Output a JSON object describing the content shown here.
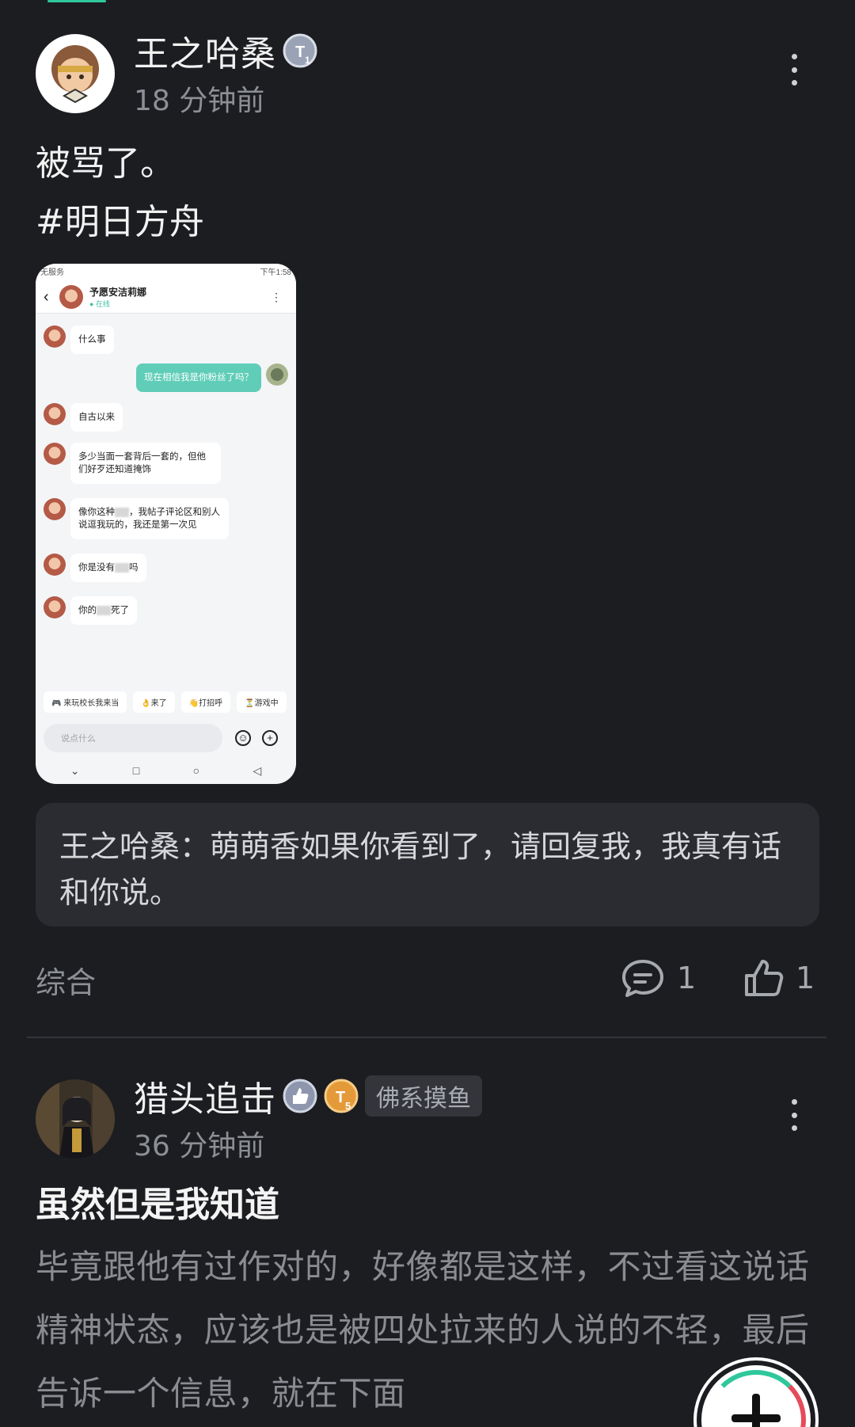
{
  "post1": {
    "author": "王之哈桑",
    "level_badge": "T1",
    "time": "18 分钟前",
    "text_lines": [
      "被骂了。",
      "#明日方舟"
    ],
    "image": {
      "status_left": "无服务",
      "status_right": "下午1:58",
      "peer_name": "予愿安洁莉娜",
      "peer_status": "● 在线",
      "messages": [
        {
          "from": "peer",
          "text": "什么事"
        },
        {
          "from": "me",
          "text": "现在相信我是你粉丝了吗？"
        },
        {
          "from": "peer",
          "text": "自古以来"
        },
        {
          "from": "peer",
          "text": "多少当面一套背后一套的，但他们好歹还知道掩饰"
        },
        {
          "from": "peer",
          "text_a": "像你这种",
          "text_b": "，我帖子评论区和别人说逗我玩的，我还是第一次见"
        },
        {
          "from": "peer",
          "text_a": "你是没有",
          "text_b": "吗"
        },
        {
          "from": "peer",
          "text_a": "你的",
          "text_b": "死了"
        }
      ],
      "quick_replies": [
        "🎮 来玩校长我来当",
        "👌来了",
        "👋打招呼",
        "⏳游戏中"
      ],
      "input_placeholder": "说点什么"
    },
    "quote": "王之哈桑：萌萌香如果你看到了，请回复我，我真有话和你说。",
    "category": "综合",
    "comment_count": "1",
    "like_count": "1"
  },
  "post2": {
    "author": "猎头追击",
    "level_badge": "T5",
    "tag": "佛系摸鱼",
    "time": "36 分钟前",
    "headline": "虽然但是我知道",
    "body": "毕竟跟他有过作对的，好像都是这样，不过看这说话精神状态，应该也是被四处拉来的人说的不轻，最后告诉一个信息，就在下面"
  },
  "colors": {
    "accent": "#2fc79b",
    "bubble_me": "#5fcdb7",
    "background": "#1c1d21"
  },
  "icons": [
    "more-vertical-icon",
    "comment-icon",
    "thumbs-up-icon",
    "plus-icon",
    "level-badge-icon"
  ]
}
